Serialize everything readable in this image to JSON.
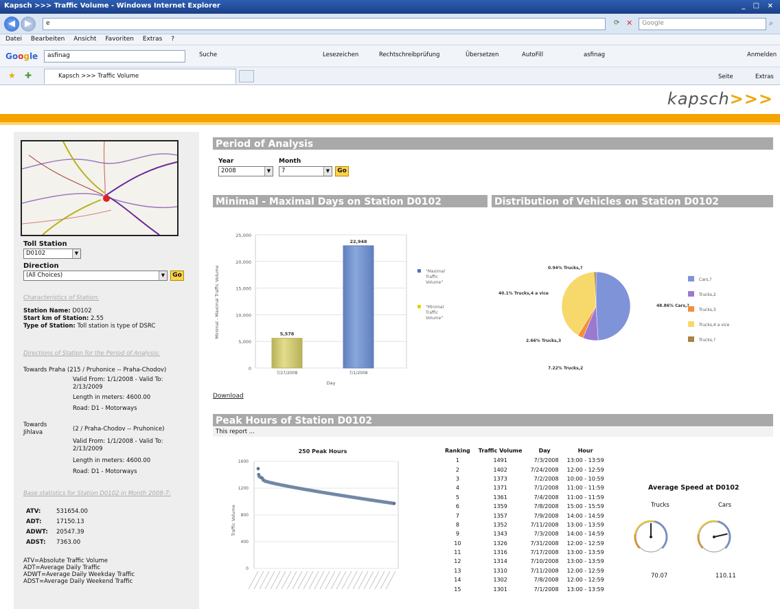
{
  "browser": {
    "title": "Kapsch >>> Traffic Volume - Windows Internet Explorer",
    "window_controls": "_ □ ×",
    "address_value": "e",
    "search_placeholder": "Google",
    "menu": [
      "Datei",
      "Bearbeiten",
      "Ansicht",
      "Favoriten",
      "Extras",
      "?"
    ],
    "google_search_value": "asfinag",
    "google_bar_items": [
      "Suche",
      "Lesezeichen",
      "Rechtschreibprüfung",
      "Übersetzen",
      "AutoFill",
      "asfinag",
      "Anmelden"
    ],
    "tab_label": "Kapsch >>> Traffic Volume",
    "command_items": [
      "Seite",
      "Extras"
    ]
  },
  "logo": {
    "text": "kapsch",
    "arrows": ">>>"
  },
  "left": {
    "toll_station_label": "Toll Station",
    "toll_station_value": "D0102",
    "direction_label": "Direction",
    "direction_value": "(All Choices)",
    "go": "Go",
    "characteristics_title": "Characteristics of Station:",
    "station_name_label": "Station Name:",
    "station_name": "D0102",
    "start_km_label": "Start km of Station:",
    "start_km": "2.55",
    "type_label": "Type of Station:",
    "type_value": "Toll station is type of DSRC",
    "directions_title": "Directions of Station for the Period of Analysis:",
    "dir1_name": "Towards Praha",
    "dir1_route": "(215 / Pruhonice -- Praha-Chodov)",
    "dir1_valid": "Valid From: 1/1/2008 - Valid To: 2/13/2009",
    "dir1_length": "Length in meters: 4600.00",
    "dir1_road": "Road: D1 - Motorways",
    "dir2_name": "Towards Jihlava",
    "dir2_route": "(2 / Praha-Chodov -- Pruhonice)",
    "dir2_valid": "Valid From: 1/1/2008 - Valid To: 2/13/2009",
    "dir2_length": "Length in meters: 4600.00",
    "dir2_road": "Road: D1 - Motorways",
    "base_title": "Base statistics for Station D0102 in Month 2008-7:",
    "stats": [
      {
        "k": "ATV:",
        "v": "531654.00"
      },
      {
        "k": "ADT:",
        "v": "17150.13"
      },
      {
        "k": "ADWT:",
        "v": "20547.39"
      },
      {
        "k": "ADST:",
        "v": "7363.00"
      }
    ],
    "legend_lines": [
      "ATV=Absolute Traffic Volume",
      "ADT=Average Daily Traffic",
      "ADWT=Average Daily Weekday Traffic",
      "ADST=Average Daily Weekend Traffic"
    ]
  },
  "period": {
    "header": "Period of Analysis",
    "year_label": "Year",
    "year_value": "2008",
    "month_label": "Month",
    "month_value": "7",
    "go": "Go"
  },
  "minmax": {
    "header": "Minimal - Maximal Days on Station D0102",
    "download": "Download"
  },
  "dist": {
    "header": "Distribution of Vehicles on Station D0102"
  },
  "peak": {
    "header": "Peak Hours of Station D0102",
    "report": "This report ...",
    "table_headers": [
      "Ranking",
      "Traffic Volume",
      "Day",
      "Hour"
    ],
    "rows": [
      [
        "1",
        "1491",
        "7/3/2008",
        "13:00 - 13:59"
      ],
      [
        "2",
        "1402",
        "7/24/2008",
        "12:00 - 12:59"
      ],
      [
        "3",
        "1373",
        "7/2/2008",
        "10:00 - 10:59"
      ],
      [
        "4",
        "1371",
        "7/1/2008",
        "11:00 - 11:59"
      ],
      [
        "5",
        "1361",
        "7/4/2008",
        "11:00 - 11:59"
      ],
      [
        "6",
        "1359",
        "7/8/2008",
        "15:00 - 15:59"
      ],
      [
        "7",
        "1357",
        "7/9/2008",
        "14:00 - 14:59"
      ],
      [
        "8",
        "1352",
        "7/11/2008",
        "13:00 - 13:59"
      ],
      [
        "9",
        "1343",
        "7/3/2008",
        "14:00 - 14:59"
      ],
      [
        "10",
        "1326",
        "7/31/2008",
        "12:00 - 12:59"
      ],
      [
        "11",
        "1316",
        "7/17/2008",
        "13:00 - 13:59"
      ],
      [
        "12",
        "1314",
        "7/10/2008",
        "13:00 - 13:59"
      ],
      [
        "13",
        "1310",
        "7/11/2008",
        "12:00 - 12:59"
      ],
      [
        "14",
        "1302",
        "7/8/2008",
        "12:00 - 12:59"
      ],
      [
        "15",
        "1301",
        "7/1/2008",
        "13:00 - 13:59"
      ]
    ]
  },
  "speed": {
    "title": "Average Speed at D0102",
    "trucks_label": "Trucks",
    "cars_label": "Cars",
    "trucks_value": "70.07",
    "cars_value": "110.11"
  },
  "chart_data": [
    {
      "type": "bar",
      "title": "",
      "xlabel": "Day",
      "ylabel": "Minimal - Maximal Traffic Volume",
      "categories": [
        "7/27/2008",
        "7/1/2008"
      ],
      "values": [
        5578,
        22948
      ],
      "value_labels": [
        "5,578",
        "22,948"
      ],
      "ylim": [
        0,
        25000
      ],
      "yticks": [
        "0",
        "5,000",
        "10,000",
        "15,000",
        "20,000",
        "25,000"
      ],
      "legend": [
        "\"Maximal Traffic Volume\"",
        "\"Minimal Traffic Volume\""
      ],
      "colors": [
        "#7f9fd6",
        "#e6e08a"
      ]
    },
    {
      "type": "pie",
      "title": "",
      "slices": [
        {
          "label": "Cars,?",
          "value": 48.86,
          "text": "48.86% Cars,?",
          "color": "#7f93d8"
        },
        {
          "label": "Trucks,2",
          "value": 7.22,
          "text": "7.22% Trucks,2",
          "color": "#9a7ad0"
        },
        {
          "label": "Trucks,3",
          "value": 2.66,
          "text": "2.66% Trucks,3",
          "color": "#f28f3b"
        },
        {
          "label": "Trucks,4 a vice",
          "value": 40.1,
          "text": "40.1% Trucks,4 a vice",
          "color": "#f7d86a"
        },
        {
          "label": "Trucks,?",
          "value": 0.94,
          "text": "0.94% Trucks,?",
          "color": "#a88444"
        }
      ],
      "legend": [
        "Cars,?",
        "Trucks,2",
        "Trucks,3",
        "Trucks,4 a vice",
        "Trucks,?"
      ]
    },
    {
      "type": "scatter",
      "title": "250 Peak Hours",
      "ylabel": "Traffic Volume",
      "ylim": [
        0,
        1600
      ],
      "yticks": [
        "0",
        "400",
        "800",
        "1200",
        "1600"
      ],
      "first_values": [
        1491,
        1402,
        1373,
        1371,
        1361,
        1359,
        1357,
        1352,
        1343,
        1326,
        1316,
        1314,
        1310,
        1302,
        1301
      ],
      "last_value": 970,
      "count": 250
    },
    {
      "type": "gauge",
      "gauges": [
        {
          "name": "Trucks",
          "value": 70.07,
          "max": 140
        },
        {
          "name": "Cars",
          "value": 110.11,
          "max": 140
        }
      ]
    }
  ]
}
